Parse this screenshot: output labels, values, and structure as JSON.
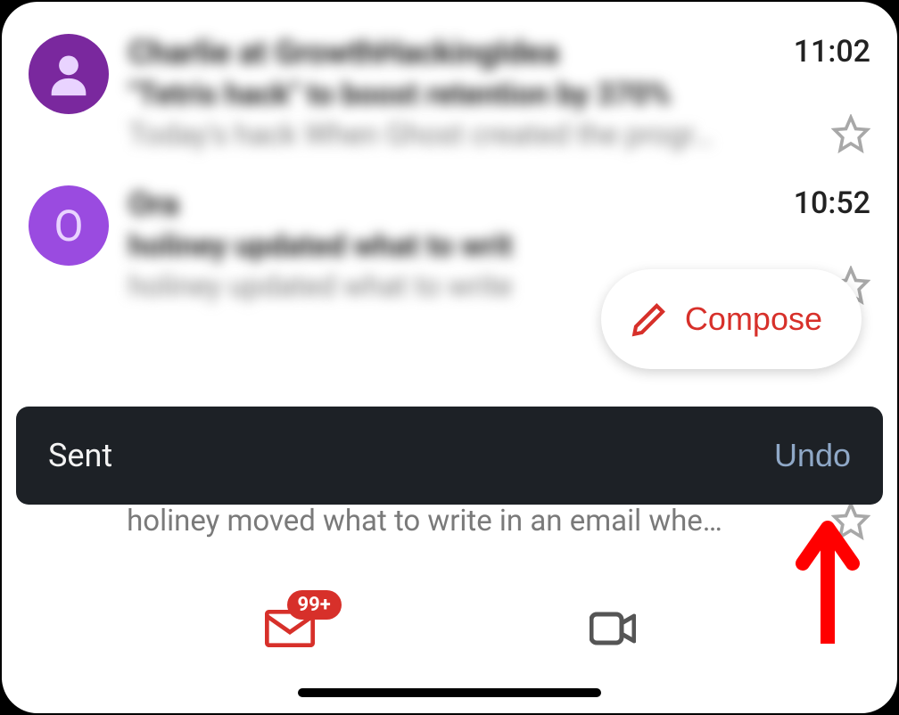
{
  "emails": [
    {
      "avatar_letter": "",
      "sender": "Charlie at GrowthHackingIdea",
      "subject": "\"Tetris hack\" to boost retention by 370%",
      "preview": "Today's hack When Ghost created the progr…",
      "time": "11:02"
    },
    {
      "avatar_letter": "O",
      "sender": "Ora",
      "subject": "holiney updated what to writ",
      "preview": "holiney updated what to write",
      "time": "10:52"
    }
  ],
  "partial_preview": "holiney moved what to write in an email whe…",
  "toast": {
    "message": "Sent",
    "action": "Undo"
  },
  "compose": {
    "label": "Compose"
  },
  "bottom": {
    "badge": "99+"
  }
}
